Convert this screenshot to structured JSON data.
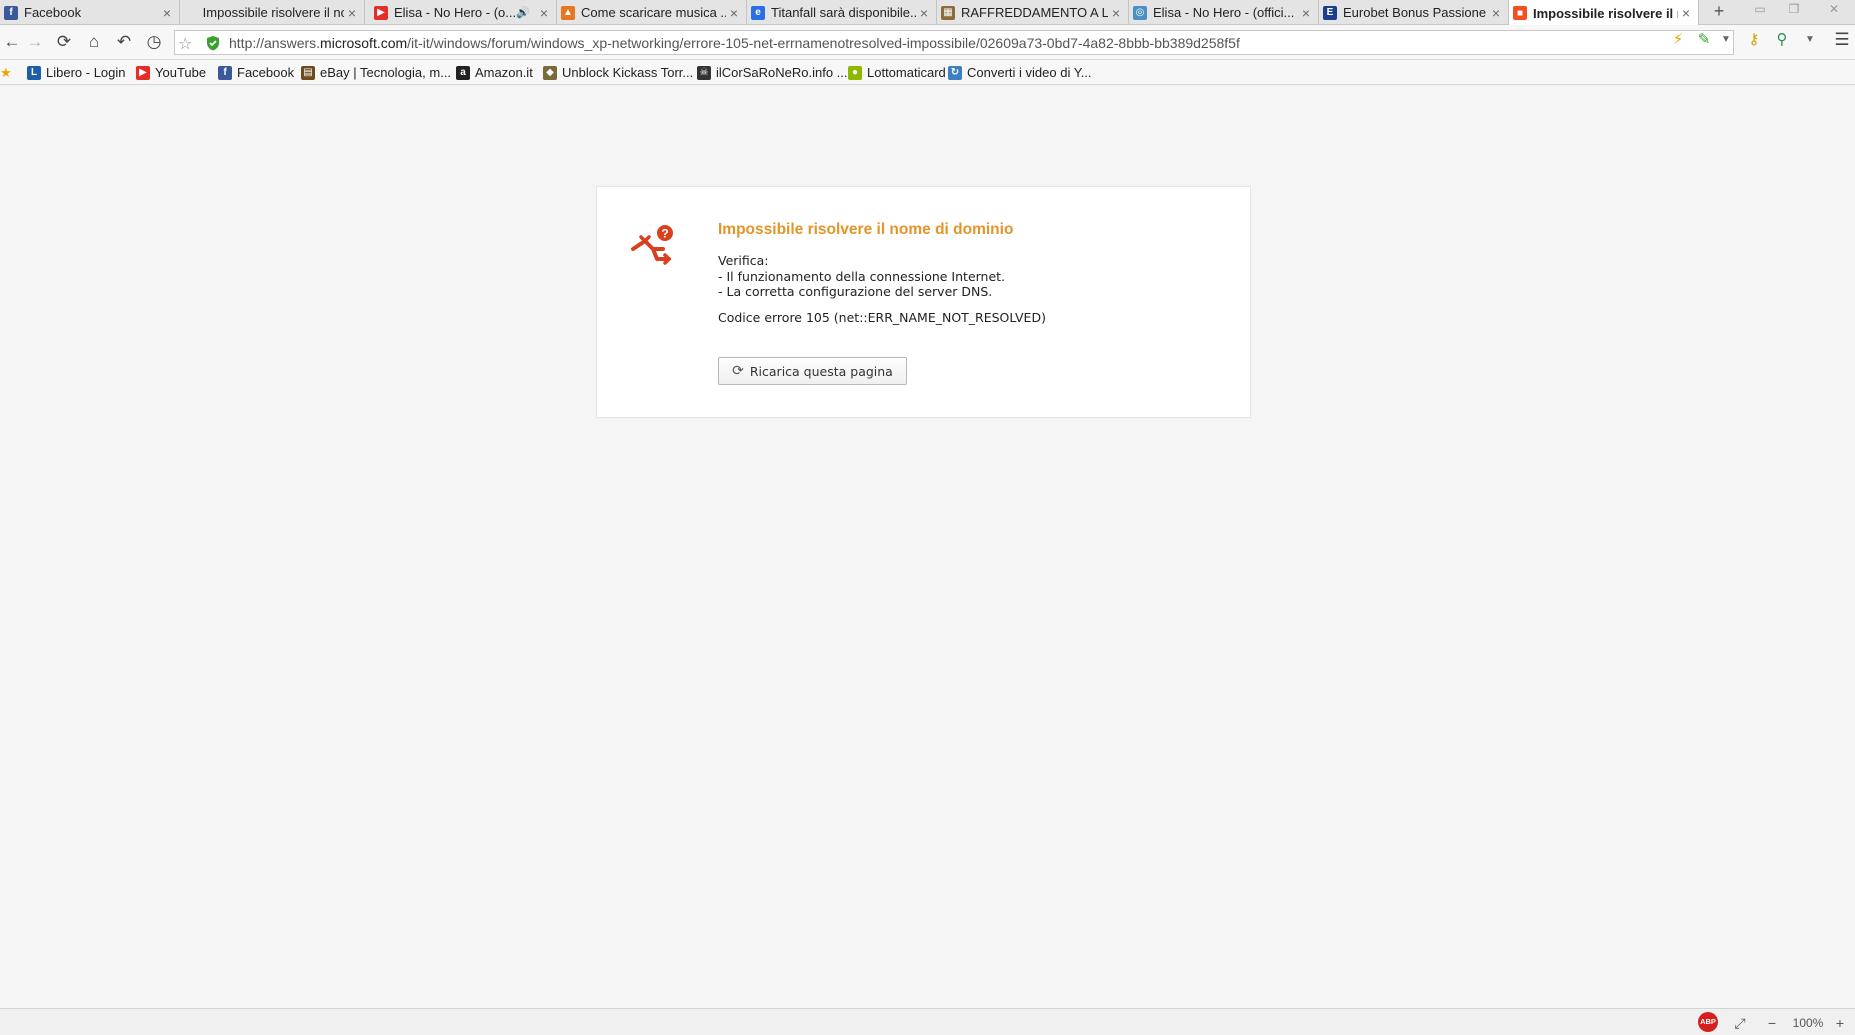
{
  "tabs": [
    {
      "label": "Facebook",
      "icon": "facebook-icon",
      "icon_color": "#3b5998",
      "glyph": "f"
    },
    {
      "label": "Impossibile risolvere il no...",
      "icon": "",
      "icon_color": "",
      "glyph": ""
    },
    {
      "label": "Elisa - No Hero - (o...",
      "icon": "youtube-icon",
      "icon_color": "#e52d27",
      "glyph": "▶",
      "audio": "🔊"
    },
    {
      "label": "Come scaricare musica ...",
      "icon": "warning-triangle-icon",
      "icon_color": "#e87722",
      "glyph": "▲"
    },
    {
      "label": "Titanfall sarà disponibile...",
      "icon": "globe-icon",
      "icon_color": "#2a6ee8",
      "glyph": "e"
    },
    {
      "label": "RAFFREDDAMENTO A LI...",
      "icon": "forum-icon",
      "icon_color": "#8a6d3b",
      "glyph": "▦"
    },
    {
      "label": "Elisa - No Hero - (offici...",
      "icon": "web-icon",
      "icon_color": "#4a90c2",
      "glyph": "◎"
    },
    {
      "label": "Eurobet Bonus Passione",
      "icon": "eurobet-icon",
      "icon_color": "#1d3d8f",
      "glyph": "E"
    },
    {
      "label": "Impossibile risolvere il n...",
      "icon": "microsoft-icon",
      "icon_color": "#f25022",
      "glyph": "■",
      "active": true
    }
  ],
  "window_controls": {
    "minimize": "▭",
    "restore": "❐",
    "close": "✕"
  },
  "newtab": "+",
  "tab_close": "×",
  "toolbar": {
    "back": "←",
    "forward": "→",
    "reload": "⟳",
    "home": "⌂",
    "undo": "↶",
    "history": "◷",
    "url_prefix": "http://answers.",
    "url_host": "microsoft.com",
    "url_path": "/it-it/windows/forum/windows_xp-networking/errore-105-net-errnamenotresolved-impossibile/02609a73-0bd7-4a82-8bbb-bb389d258f5f",
    "star": "☆",
    "menu": "☰"
  },
  "bookmarks": [
    {
      "label": "Libero - Login",
      "icon": "libero-icon",
      "color": "#1c5fa8",
      "glyph": "L"
    },
    {
      "label": "YouTube",
      "icon": "youtube-icon",
      "color": "#e52d27",
      "glyph": "▶"
    },
    {
      "label": "Facebook",
      "icon": "facebook-icon",
      "color": "#3b5998",
      "glyph": "f"
    },
    {
      "label": "eBay | Tecnologia, m...",
      "icon": "ebay-icon",
      "color": "#6f4a1e",
      "glyph": "▤"
    },
    {
      "label": "Amazon.it",
      "icon": "amazon-icon",
      "color": "#222222",
      "glyph": "a"
    },
    {
      "label": "Unblock Kickass Torr...",
      "icon": "shield-icon",
      "color": "#7a6a3a",
      "glyph": "◆"
    },
    {
      "label": "ilCorSaRoNeRo.info ...",
      "icon": "skull-icon",
      "color": "#333333",
      "glyph": "☠"
    },
    {
      "label": "Lottomaticard",
      "icon": "lottomatica-icon",
      "color": "#8cb800",
      "glyph": "●"
    },
    {
      "label": "Converti i video di Y...",
      "icon": "convert-icon",
      "color": "#3f7fbf",
      "glyph": "↻"
    }
  ],
  "error": {
    "title": "Impossibile risolvere il nome di dominio",
    "verifica": "Verifica:",
    "line1": "- Il funzionamento della connessione Internet.",
    "line2": "- La corretta configurazione del server DNS.",
    "code": "Codice errore 105 (net::ERR_NAME_NOT_RESOLVED)",
    "button": "Ricarica questa pagina",
    "accent_color": "#e39527",
    "icon_color": "#d9411e"
  },
  "statusbar": {
    "abp": "ABP",
    "fullscreen": "⤢",
    "zoom_out": "−",
    "zoom": "100%",
    "zoom_in": "+"
  }
}
